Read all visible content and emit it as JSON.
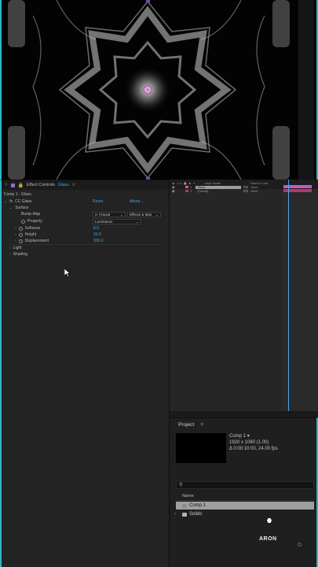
{
  "effect_controls": {
    "tab_title": "Effect Controls",
    "tab_layer": "Glass",
    "comp_path": "Comp 1 - Glass",
    "effect_name": "CC Glass",
    "reset_label": "Reset",
    "about_label": "About...",
    "surface_label": "Surface",
    "bump_map_label": "Bump Map",
    "bump_map_value": "2. Fractal",
    "bump_map_source": "Effects & Mas",
    "property_label": "Property",
    "property_value": "Luminance",
    "softness_label": "Softness",
    "softness_value": "8.0",
    "height_label": "Height",
    "height_value": "20.0",
    "displacement_label": "Displacement",
    "displacement_value": "300.0",
    "light_label": "Light",
    "shading_label": "Shading"
  },
  "timeline": {
    "col_layer_name": "Layer Name",
    "col_parent": "Parent & Link",
    "layers": [
      {
        "num": "1",
        "name": "Glass",
        "parent": "None",
        "color": "#c45ac0"
      },
      {
        "num": "2",
        "name": "[Fractal]",
        "parent": "None",
        "color": "#b0396e"
      }
    ]
  },
  "project": {
    "title": "Project",
    "comp_name": "Comp 1",
    "comp_res": "1920 x 1080 (1.00)",
    "comp_dur": "Δ 0:00:10:00, 24.00 fps",
    "name_col": "Name",
    "items": [
      {
        "name": "Comp 1",
        "selected": true,
        "icon_color": "#8c8c8c"
      },
      {
        "name": "Solids",
        "selected": false,
        "icon_color": "#b4b4b4"
      }
    ]
  },
  "watermark": "ARON",
  "colors": {
    "accent_blue": "#3ea6e6",
    "frame_cyan": "#2fb7c6",
    "layer_purple": "#c45ac0",
    "layer_magenta": "#b0396e"
  }
}
